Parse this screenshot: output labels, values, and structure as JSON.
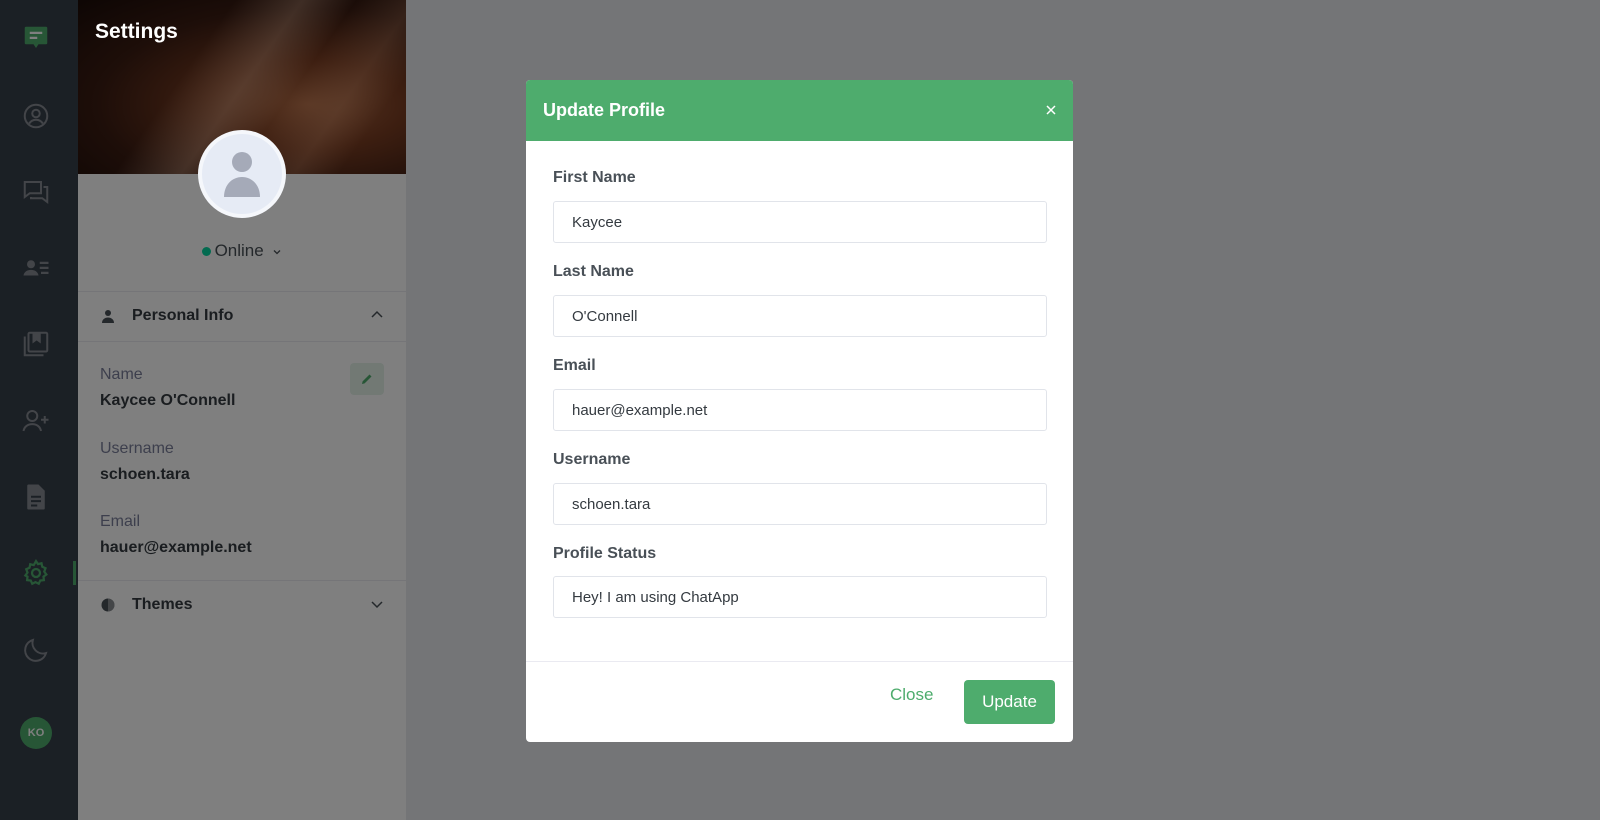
{
  "sidebar": {
    "avatar_initials": "KO",
    "icons": [
      "chat-logo-icon",
      "user-circle-icon",
      "message-icon",
      "contacts-icon",
      "bookmark-icon",
      "user-plus-icon",
      "document-icon",
      "gear-icon",
      "moon-icon"
    ]
  },
  "settings": {
    "title": "Settings",
    "status": "Online",
    "personal_info": {
      "heading": "Personal Info",
      "name_label": "Name",
      "name_value": "Kaycee O'Connell",
      "username_label": "Username",
      "username_value": "schoen.tara",
      "email_label": "Email",
      "email_value": "hauer@example.net"
    },
    "themes_heading": "Themes"
  },
  "modal": {
    "title": "Update Profile",
    "first_name_label": "First Name",
    "first_name_value": "Kaycee",
    "last_name_label": "Last Name",
    "last_name_value": "O'Connell",
    "email_label": "Email",
    "email_value": "hauer@example.net",
    "username_label": "Username",
    "username_value": "schoen.tara",
    "status_label": "Profile Status",
    "status_value": "Hey! I am using ChatApp",
    "close_label": "Close",
    "update_label": "Update"
  },
  "colors": {
    "accent": "#4eac6d",
    "rail": "#36404a",
    "online": "#06d6a0"
  }
}
